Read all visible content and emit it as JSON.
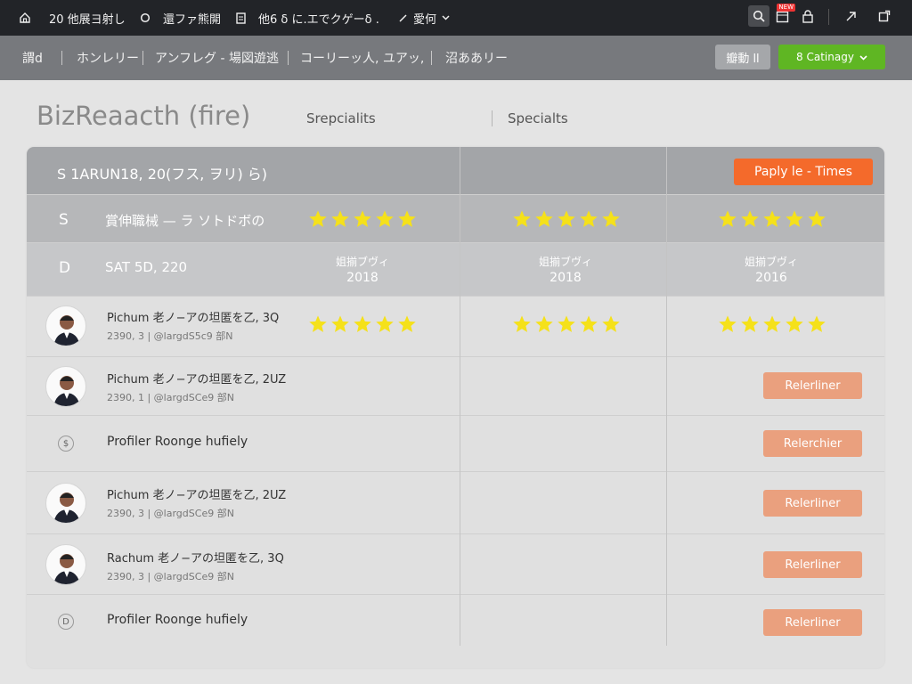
{
  "topbar": {
    "home_label": "20 他展ヨ射し",
    "item2_label": "還ファ熊開",
    "item3_label": "他6 δ に.エでクゲーδ .",
    "item4_label": "愛何",
    "notif_badge": "NEW"
  },
  "nav": {
    "item1": "謂d",
    "item2": "ホンレリー",
    "item3": "アンフレグ - 場図遊逃",
    "item4": "コーリーッ人, ユアッ,",
    "item5": "沼ああリー",
    "btn_grey": "瓣動 ll",
    "btn_green": "8 Catinagy"
  },
  "header": {
    "brand": "BizReaacth (fire)",
    "tab1": "Srepcialits",
    "tab2": "Specialts"
  },
  "table": {
    "title": "S 1ARUN18, 20(フス, ヲリ) ら)",
    "apply_button": "Paply le - Times",
    "row2": {
      "letter": "S",
      "label": "賞伸職械 — ラ ソトドボの"
    },
    "row3": {
      "letter": "D",
      "label": "SAT 5D, 220",
      "cols": [
        {
          "label": "姐揃ブヴィ",
          "year": "2018"
        },
        {
          "label": "姐揃ブヴィ",
          "year": "2018"
        },
        {
          "label": "姐揃ブヴィ",
          "year": "2016"
        }
      ]
    },
    "rows": [
      {
        "name": "Pichum 老ノ−アの坦匿を乙, 3Q",
        "meta": "2390, 3 | @largdS5c9 部N",
        "stars": 5,
        "button": ""
      },
      {
        "name": "Pichum 老ノ−アの坦匿を乙, 2UZ",
        "meta": "2390, 1 | @largdSCe9 部N",
        "button": "Relerliner"
      },
      {
        "name": "Profiler Roonge hufiely",
        "icon": "$",
        "button": "Relerchier"
      },
      {
        "name": "Pichum 老ノ−アの坦匿を乙, 2UZ",
        "meta": "2390, 3 | @largdSCe9 部N",
        "button": "Relerliner"
      },
      {
        "name": "Rachum 老ノ−アの坦匿を乙, 3Q",
        "meta": "2390, 3 | @largdSCe9 部N",
        "button": "Relerliner"
      },
      {
        "name": "Profiler Roonge hufiely",
        "icon": "D",
        "button": "Relerliner"
      }
    ],
    "header_stars": 5
  },
  "colors": {
    "accent_orange": "#f46a2b",
    "row_button": "#eaa07e",
    "green_button": "#5fb623",
    "star": "#f5e11a"
  }
}
